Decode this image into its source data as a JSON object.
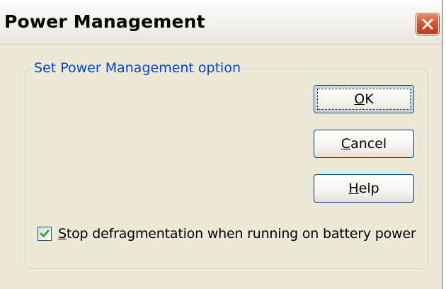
{
  "window": {
    "title": "Power Management"
  },
  "group": {
    "label": "Set Power Management option"
  },
  "buttons": {
    "ok": {
      "accel": "O",
      "rest": "K"
    },
    "cancel": {
      "accel": "C",
      "rest": "ancel"
    },
    "help": {
      "accel": "H",
      "rest": "elp"
    }
  },
  "option": {
    "checked": true,
    "label_accel": "S",
    "label_rest": "top defragmentation when running on battery power"
  },
  "icons": {
    "close": "close-icon",
    "check": "checkmark-icon"
  },
  "colors": {
    "dialog_background": "#ece9d8",
    "group_label": "#0046d5",
    "close_button": "#d4512f",
    "checkmark": "#21a121",
    "button_border": "#003c74"
  }
}
